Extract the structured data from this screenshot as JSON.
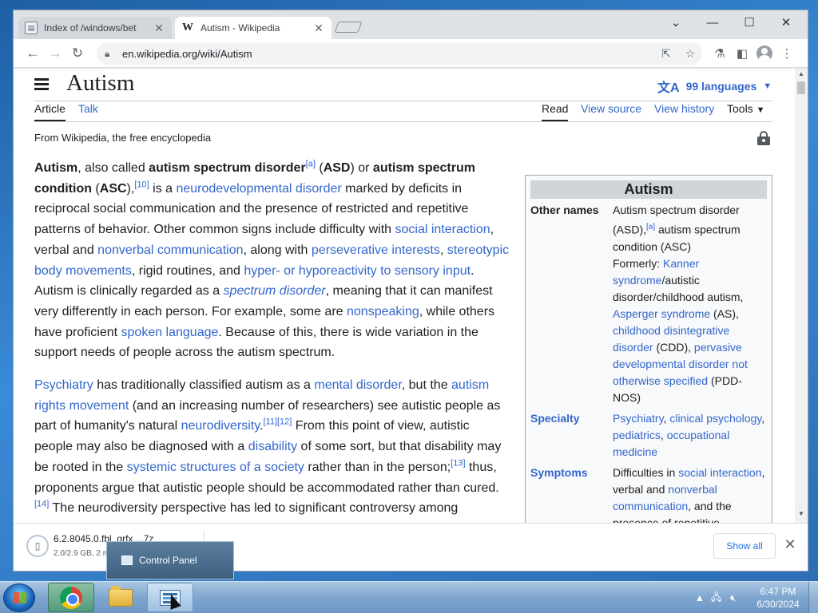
{
  "browser": {
    "tabs": [
      {
        "label": "Index of /windows/bet",
        "icon": "document-icon",
        "close": "✕"
      },
      {
        "label": "Autism - Wikipedia",
        "icon": "wikipedia-icon",
        "close": "✕"
      }
    ],
    "window_controls": {
      "dropdown": "⌄",
      "minimize": "—",
      "maximize": "☐",
      "close": "✕"
    },
    "url": "en.wikipedia.org/wiki/Autism"
  },
  "page": {
    "title": "Autism",
    "languages": "99 languages",
    "tabs_left": [
      "Article",
      "Talk"
    ],
    "tabs_right": [
      "Read",
      "View source",
      "View history",
      "Tools"
    ],
    "from": "From Wikipedia, the free encyclopedia"
  },
  "article": {
    "p1": [
      {
        "t": "b",
        "v": "Autism"
      },
      {
        "t": "n",
        "v": ", also called "
      },
      {
        "t": "b",
        "v": "autism spectrum disorder"
      },
      {
        "t": "s",
        "v": "[a]"
      },
      {
        "t": "n",
        "v": " ("
      },
      {
        "t": "b",
        "v": "ASD"
      },
      {
        "t": "n",
        "v": ") or "
      },
      {
        "t": "b",
        "v": "autism spectrum condition"
      },
      {
        "t": "n",
        "v": " ("
      },
      {
        "t": "b",
        "v": "ASC"
      },
      {
        "t": "n",
        "v": "),"
      },
      {
        "t": "s",
        "v": "[10]"
      },
      {
        "t": "n",
        "v": " is a "
      },
      {
        "t": "a",
        "v": "neurodevelopmental disorder"
      },
      {
        "t": "n",
        "v": " marked by deficits in reciprocal social communication and the presence of restricted and repetitive patterns of behavior. Other common signs include difficulty with "
      },
      {
        "t": "a",
        "v": "social interaction"
      },
      {
        "t": "n",
        "v": ", verbal and "
      },
      {
        "t": "a",
        "v": "nonverbal communication"
      },
      {
        "t": "n",
        "v": ", along with "
      },
      {
        "t": "a",
        "v": "perseverative interests"
      },
      {
        "t": "n",
        "v": ", "
      },
      {
        "t": "a",
        "v": "stereotypic body movements"
      },
      {
        "t": "n",
        "v": ", rigid routines, and "
      },
      {
        "t": "a",
        "v": "hyper- or hyporeactivity to sensory input"
      },
      {
        "t": "n",
        "v": ". Autism is clinically regarded as a "
      },
      {
        "t": "ai",
        "v": "spectrum disorder"
      },
      {
        "t": "n",
        "v": ", meaning that it can manifest very differently in each person. For example, some are "
      },
      {
        "t": "a",
        "v": "nonspeaking"
      },
      {
        "t": "n",
        "v": ", while others have proficient "
      },
      {
        "t": "a",
        "v": "spoken language"
      },
      {
        "t": "n",
        "v": ". Because of this, there is wide variation in the support needs of people across the autism spectrum."
      }
    ],
    "p2": [
      {
        "t": "a",
        "v": "Psychiatry"
      },
      {
        "t": "n",
        "v": " has traditionally classified autism as a "
      },
      {
        "t": "a",
        "v": "mental disorder"
      },
      {
        "t": "n",
        "v": ", but the "
      },
      {
        "t": "a",
        "v": "autism rights movement"
      },
      {
        "t": "n",
        "v": " (and an increasing number of researchers) see autistic people as part of humanity's natural "
      },
      {
        "t": "a",
        "v": "neurodiversity"
      },
      {
        "t": "n",
        "v": "."
      },
      {
        "t": "s",
        "v": "[11][12]"
      },
      {
        "t": "n",
        "v": " From this point of view, autistic people may also be diagnosed with a "
      },
      {
        "t": "a",
        "v": "disability"
      },
      {
        "t": "n",
        "v": " of some sort, but that disability may be rooted in the "
      },
      {
        "t": "a",
        "v": "systemic structures of a society"
      },
      {
        "t": "n",
        "v": " rather than in the person;"
      },
      {
        "t": "s",
        "v": "[13]"
      },
      {
        "t": "n",
        "v": " thus, proponents argue that autistic people should be accommodated rather than cured."
      },
      {
        "t": "s",
        "v": "[14]"
      },
      {
        "t": "n",
        "v": " The neurodiversity perspective has led to significant controversy among"
      }
    ]
  },
  "infobox": {
    "title": "Autism",
    "rows": [
      {
        "key": "Other names",
        "key_link": false,
        "value": [
          {
            "t": "n",
            "v": "Autism spectrum disorder (ASD),"
          },
          {
            "t": "s",
            "v": "[a]"
          },
          {
            "t": "n",
            "v": " autism spectrum condition (ASC)"
          },
          {
            "t": "br",
            "v": ""
          },
          {
            "t": "n",
            "v": "Formerly: "
          },
          {
            "t": "a",
            "v": "Kanner syndrome"
          },
          {
            "t": "n",
            "v": "/autistic disorder/childhood autism, "
          },
          {
            "t": "a",
            "v": "Asperger syndrome"
          },
          {
            "t": "n",
            "v": " (AS), "
          },
          {
            "t": "a",
            "v": "childhood disintegrative disorder"
          },
          {
            "t": "n",
            "v": " (CDD), "
          },
          {
            "t": "a",
            "v": "pervasive developmental disorder not otherwise specified"
          },
          {
            "t": "n",
            "v": " (PDD-NOS)"
          }
        ]
      },
      {
        "key": "Specialty",
        "key_link": true,
        "value": [
          {
            "t": "a",
            "v": "Psychiatry"
          },
          {
            "t": "n",
            "v": ", "
          },
          {
            "t": "a",
            "v": "clinical psychology"
          },
          {
            "t": "n",
            "v": ", "
          },
          {
            "t": "a",
            "v": "pediatrics"
          },
          {
            "t": "n",
            "v": ", "
          },
          {
            "t": "a",
            "v": "occupational medicine"
          }
        ]
      },
      {
        "key": "Symptoms",
        "key_link": true,
        "value": [
          {
            "t": "n",
            "v": "Difficulties in "
          },
          {
            "t": "a",
            "v": "social interaction"
          },
          {
            "t": "n",
            "v": ", verbal and "
          },
          {
            "t": "a",
            "v": "nonverbal communication"
          },
          {
            "t": "n",
            "v": ", and the presence of repetitive"
          }
        ]
      }
    ]
  },
  "download": {
    "filename": "6.2.8045.0.fbl_grfx....7z",
    "size": "2.0/2.9 GB, 2 m",
    "show_all": "Show all",
    "close": "✕"
  },
  "taskbar": {
    "tooltip": "Control Panel",
    "time": "6:47 PM",
    "date": "6/30/2024"
  },
  "colors": {
    "link": "#3366cc",
    "text": "#202122"
  }
}
